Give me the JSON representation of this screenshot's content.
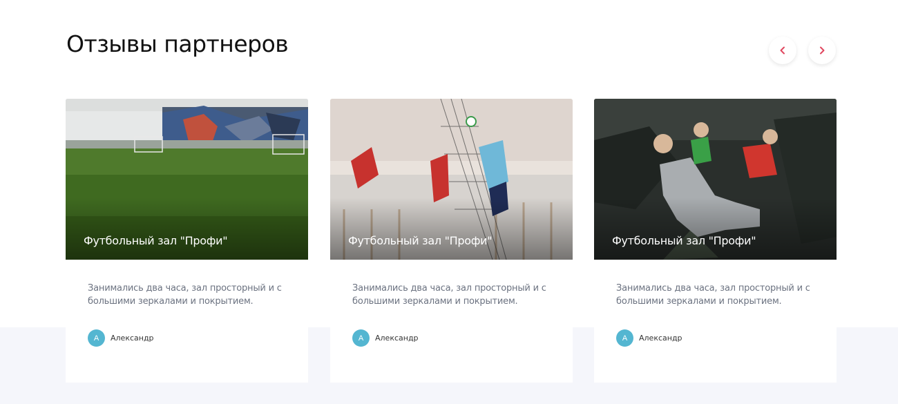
{
  "section": {
    "title": "Отзывы партнеров"
  },
  "nav": {
    "prev_symbol": "<",
    "next_symbol": ">"
  },
  "colors": {
    "accent": "#e0465e",
    "avatar": "#54b6d1",
    "band": "#f5f6fb"
  },
  "cards": [
    {
      "image_icon": "football-hall-image",
      "title": "Футбольный зал \"Профи\"",
      "text": "Занимались два часа, зал просторный и с большими зеркалами и покрытием.",
      "author_initial": "А",
      "author_name": "Александр"
    },
    {
      "image_icon": "volleyball-image",
      "title": "Футбольный зал \"Профи\"",
      "text": "Занимались два часа, зал просторный и с большими зеркалами и покрытием.",
      "author_initial": "А",
      "author_name": "Александр"
    },
    {
      "image_icon": "dancers-image",
      "title": "Футбольный зал \"Профи\"",
      "text": "Занимались два часа, зал просторный и с большими зеркалами и покрытием.",
      "author_initial": "А",
      "author_name": "Александр"
    }
  ]
}
